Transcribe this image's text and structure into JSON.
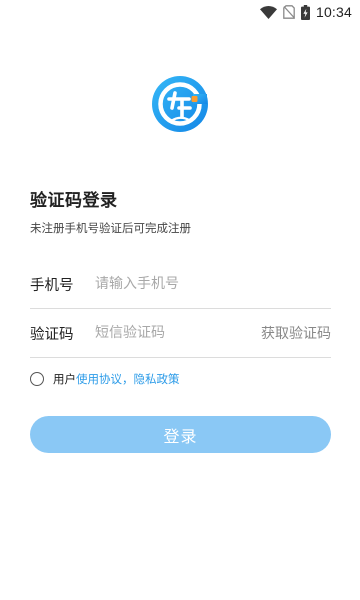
{
  "status_bar": {
    "time": "10:34",
    "icons": [
      "wifi-icon",
      "no-sim-icon",
      "battery-charging-icon"
    ]
  },
  "logo": {
    "icon": "app-logo-icon",
    "brand_color": "#1a9cf0"
  },
  "header": {
    "title": "验证码登录",
    "subtitle": "未注册手机号验证后可完成注册"
  },
  "form": {
    "phone": {
      "label": "手机号",
      "placeholder": "请输入手机号",
      "value": ""
    },
    "code": {
      "label": "验证码",
      "placeholder": "短信验证码",
      "value": "",
      "get_code_label": "获取验证码"
    }
  },
  "agreement": {
    "checked": false,
    "prefix": "用户",
    "link_text": "使用协议，隐私政策",
    "link_color": "#2b9be8"
  },
  "login_button": {
    "label": "登录",
    "color": "#8ac8f5"
  }
}
